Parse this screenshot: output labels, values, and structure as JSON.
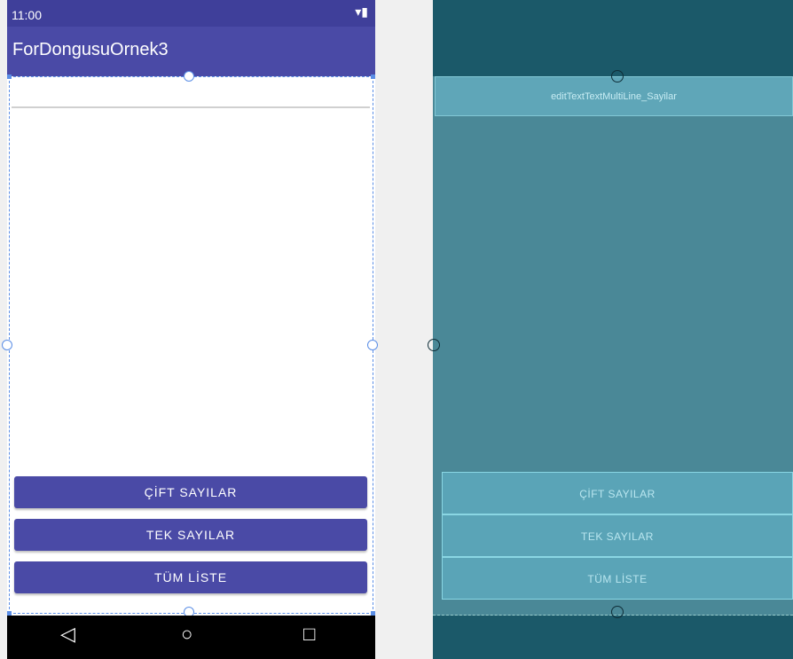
{
  "status_bar": {
    "time": "11:00",
    "icons": "▾▮"
  },
  "app_bar": {
    "title": "ForDongusuOrnek3"
  },
  "edit_text": {
    "value": ""
  },
  "buttons": {
    "even": "ÇİFT SAYILAR",
    "odd": "TEK SAYILAR",
    "all": "TÜM LİSTE"
  },
  "nav": {
    "back": "◁",
    "home": "○",
    "recents": "□"
  },
  "blueprint": {
    "edit_text_id": "editTextTextMultiLine_Sayilar",
    "buttons": {
      "even": "ÇİFT SAYILAR",
      "odd": "TEK SAYILAR",
      "all": "TÜM LİSTE"
    }
  },
  "colors": {
    "primary": "#4a4aa6",
    "primary_dark": "#3f3f9a",
    "blueprint_bg": "#1b5969",
    "blueprint_area": "#4a8897"
  }
}
